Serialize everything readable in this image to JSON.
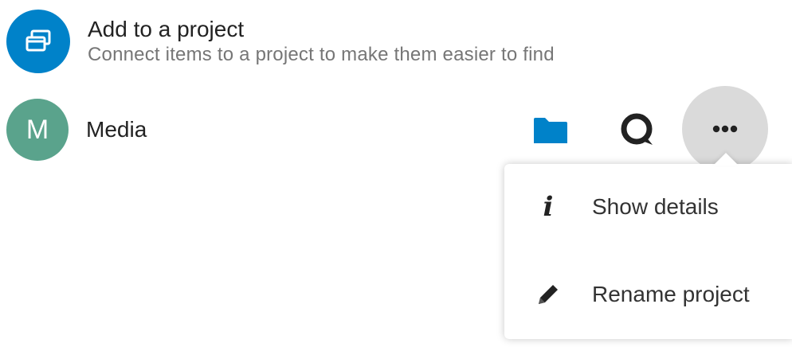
{
  "colors": {
    "accent": "#0082c9",
    "avatar": "#5aa38c",
    "folder": "#0082c9"
  },
  "add_to_project": {
    "icon": "project-stack-icon",
    "title": "Add to a project",
    "subtitle": "Connect items to a project to make them easier to find"
  },
  "project": {
    "avatar_letter": "M",
    "name": "Media",
    "actions": {
      "folder_icon": "folder-icon",
      "talk_icon": "talk-icon",
      "more_icon": "more-options-icon"
    }
  },
  "menu": {
    "items": [
      {
        "icon": "info-icon",
        "glyph": "i",
        "label": "Show details"
      },
      {
        "icon": "pencil-icon",
        "label": "Rename project"
      }
    ]
  }
}
